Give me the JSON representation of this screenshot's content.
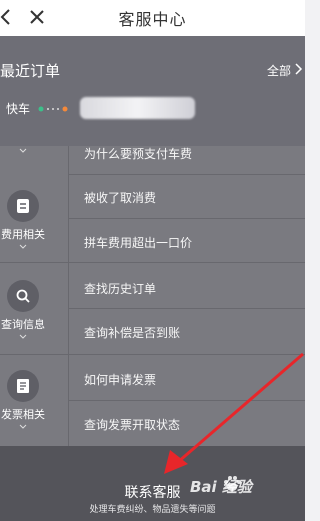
{
  "topbar": {
    "title": "客服中心"
  },
  "recent_orders": {
    "title": "最近订单",
    "all_label": "全部",
    "order_type": "快车"
  },
  "categories": [
    {
      "label": "费用相关",
      "icon": "bill-icon",
      "questions": [
        "为什么要预支付车费",
        "被收了取消费",
        "拼车费用超出一口价"
      ]
    },
    {
      "label": "查询信息",
      "icon": "search-icon",
      "questions": [
        "查找历史订单",
        "查询补偿是否到账"
      ]
    },
    {
      "label": "发票相关",
      "icon": "invoice-icon",
      "questions": [
        "如何申请发票",
        "查询发票开取状态"
      ]
    }
  ],
  "contact": {
    "label": "联系客服",
    "subtitle": "处理车费纠纷、物品遗失等问题"
  },
  "watermark": {
    "text": "Bai  经验"
  },
  "colors": {
    "overlay": "#6e6e76",
    "annotation_arrow": "#e8262a"
  }
}
